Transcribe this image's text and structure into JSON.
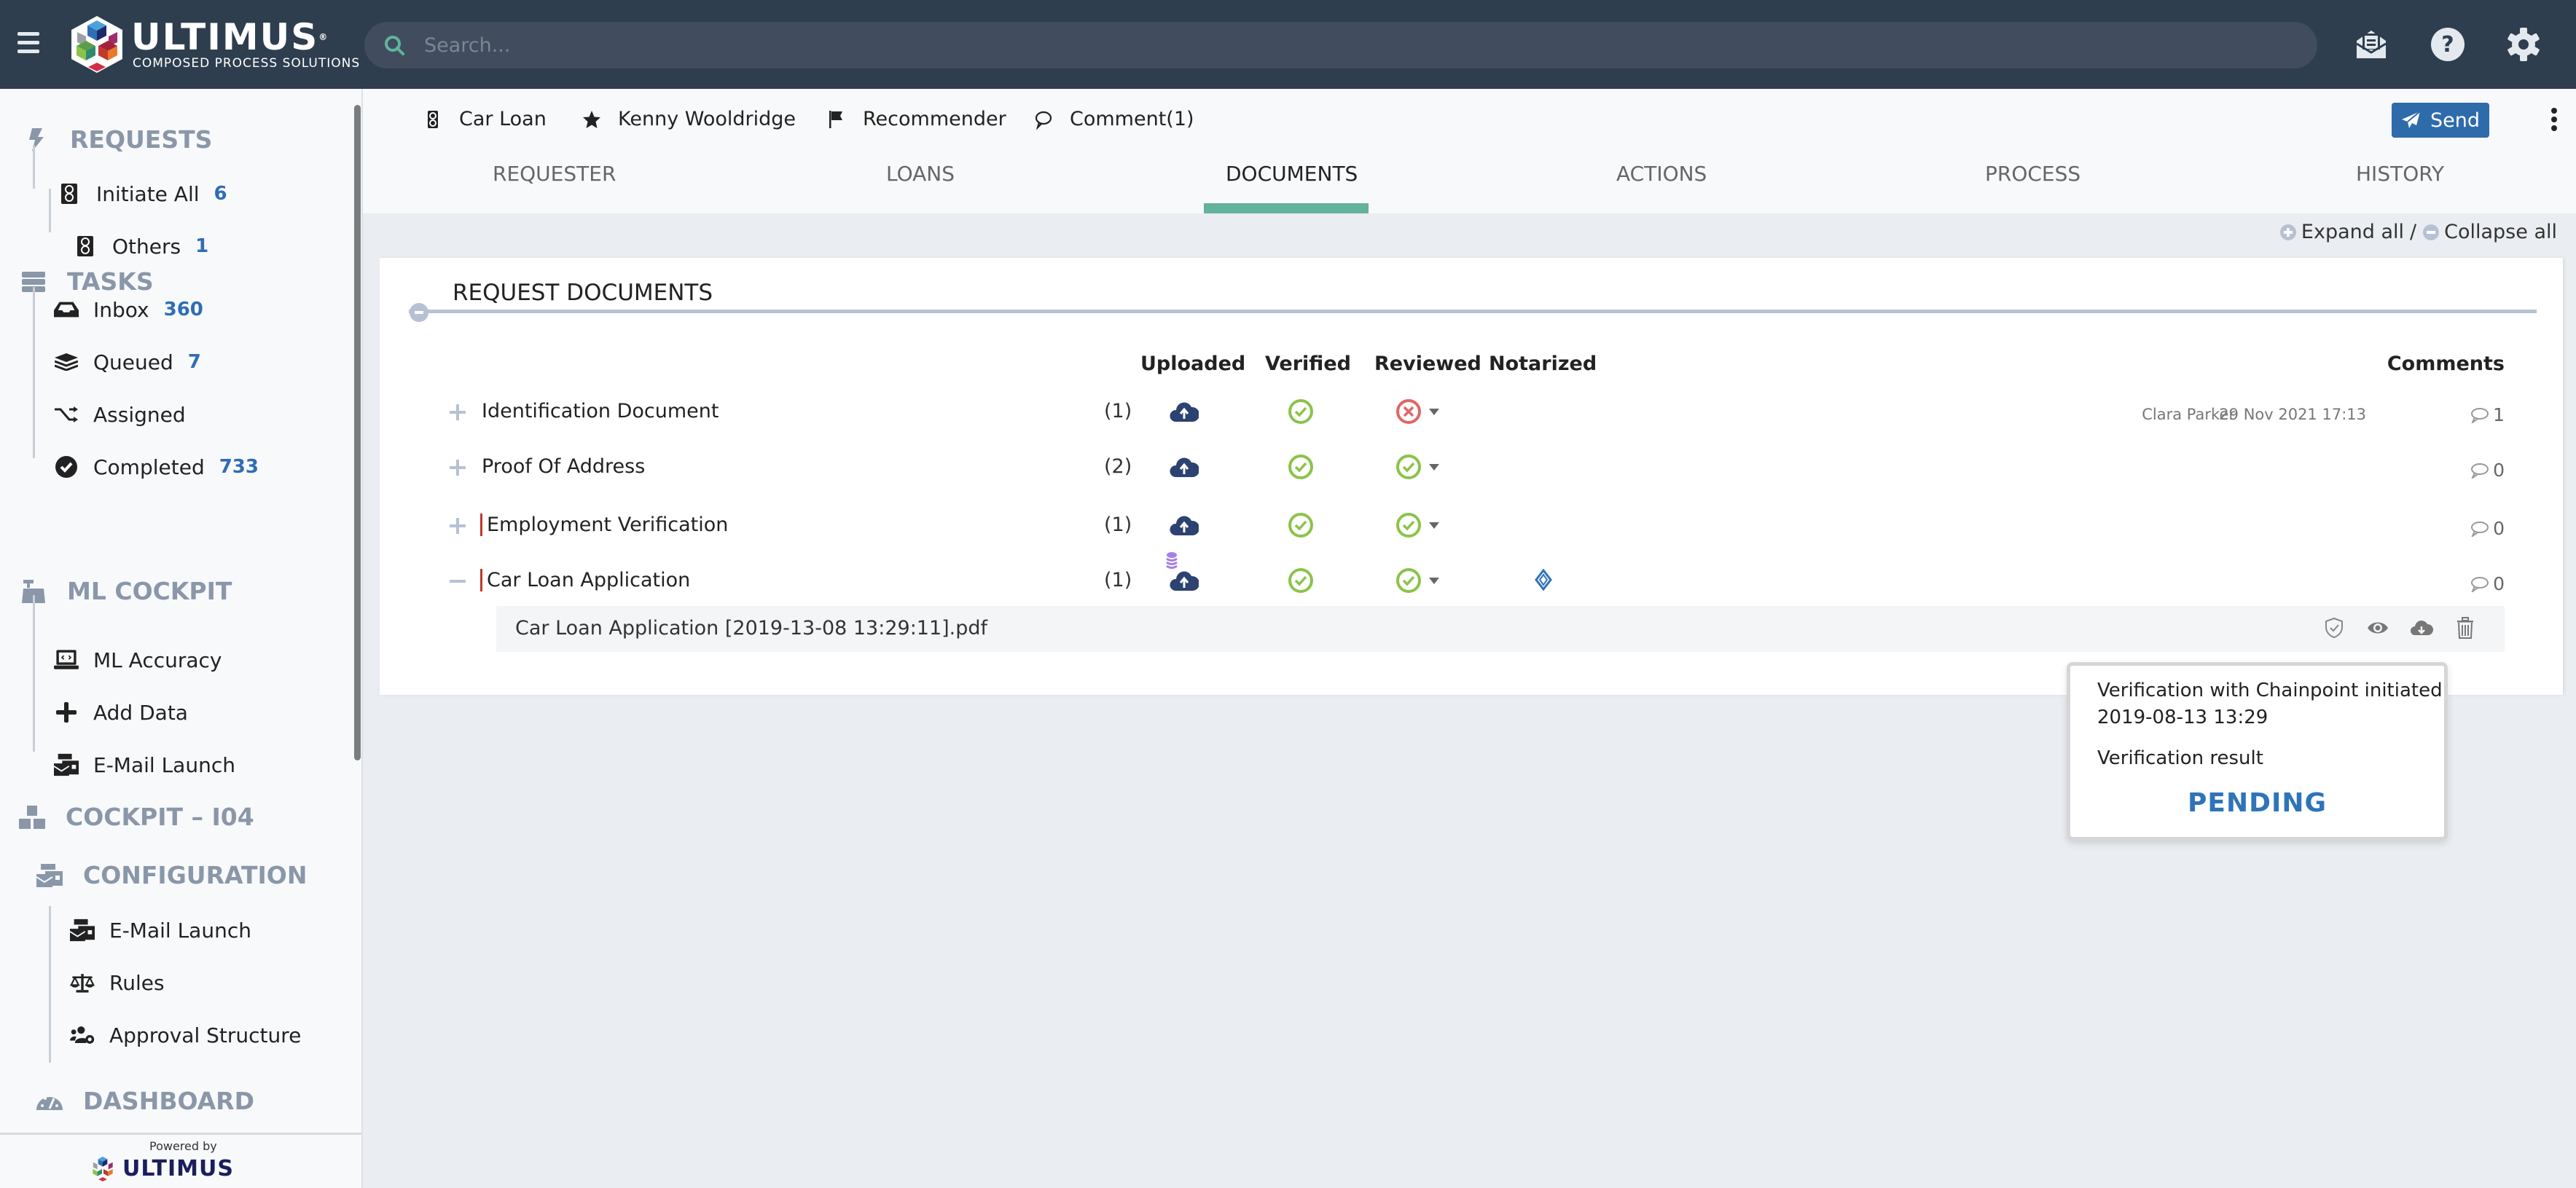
{
  "header": {
    "menu_icon": "hamburger-icon",
    "logo": {
      "name": "ULTIMUS",
      "tagline": "Composed Process Solutions",
      "registered": "®"
    },
    "search": {
      "placeholder": "Search...",
      "value": ""
    },
    "icons": [
      "inbox-mail-icon",
      "help-icon",
      "settings-gear-icon"
    ]
  },
  "sidebar": {
    "sections": [
      {
        "label": "REQUESTS",
        "icon": "bolt-icon"
      },
      {
        "label": "TASKS",
        "icon": "server-icon"
      },
      {
        "label": "ML COCKPIT",
        "icon": "cash-register-icon"
      },
      {
        "label": "COCKPIT – I04",
        "icon": "boxes-icon"
      },
      {
        "label": "CONFIGURATION",
        "icon": "mail-bulk-icon"
      },
      {
        "label": "DASHBOARD",
        "icon": "tachometer-icon"
      }
    ],
    "items": [
      {
        "label": "Initiate All",
        "count": "6",
        "icon": "traffic-light-icon"
      },
      {
        "label": "Others",
        "count": "1",
        "icon": "traffic-light-icon"
      },
      {
        "label": "Inbox",
        "count": "360",
        "icon": "inbox-icon"
      },
      {
        "label": "Queued",
        "count": "7",
        "icon": "layers-icon"
      },
      {
        "label": "Assigned",
        "count": "",
        "icon": "random-icon"
      },
      {
        "label": "Completed",
        "count": "733",
        "icon": "check-circle-icon"
      },
      {
        "label": "ML Accuracy",
        "count": "",
        "icon": "laptop-code-icon"
      },
      {
        "label": "Add Data",
        "count": "",
        "icon": "plus-icon"
      },
      {
        "label": "E-Mail Launch",
        "count": "",
        "icon": "mail-bulk-icon"
      },
      {
        "label": "E-Mail Launch",
        "count": "",
        "icon": "mail-bulk-icon"
      },
      {
        "label": "Rules",
        "count": "",
        "icon": "balance-scale-icon"
      },
      {
        "label": "Approval Structure",
        "count": "",
        "icon": "users-cog-icon"
      }
    ],
    "footer": {
      "powered_by": "Powered by",
      "brand": "ULTIMUS"
    }
  },
  "request": {
    "meta": [
      {
        "label": "Car Loan",
        "icon": "traffic-light-icon"
      },
      {
        "label": "Kenny Wooldridge",
        "icon": "star-icon"
      },
      {
        "label": "Recommender",
        "icon": "flag-icon"
      },
      {
        "label": "Comment(1)",
        "icon": "comment-icon"
      }
    ],
    "send_label": "Send",
    "tabs": [
      {
        "label": "REQUESTER",
        "active": false
      },
      {
        "label": "LOANS",
        "active": false
      },
      {
        "label": "DOCUMENTS",
        "active": true
      },
      {
        "label": "ACTIONS",
        "active": false
      },
      {
        "label": "PROCESS",
        "active": false
      },
      {
        "label": "HISTORY",
        "active": false
      }
    ],
    "expand_all": "Expand all",
    "separator": "/",
    "collapse_all": "Collapse all",
    "accent_color": "#63b29b"
  },
  "documents": {
    "title": "REQUEST DOCUMENTS",
    "columns": {
      "uploaded": "Uploaded",
      "verified": "Verified",
      "reviewed": "Reviewed",
      "notarized": "Notarized",
      "comments": "Comments"
    },
    "rows": [
      {
        "name": "Identification Document",
        "count": "(1)",
        "expanded": false,
        "flagged": false,
        "uploaded": "uploaded",
        "verified": "ok",
        "reviewed": "rejected",
        "notarized": "",
        "comment_author": "Clara Parker",
        "comment_date": "29 Nov 2021 17:13",
        "comments": "1"
      },
      {
        "name": "Proof Of Address",
        "count": "(2)",
        "expanded": false,
        "flagged": false,
        "uploaded": "uploaded",
        "verified": "ok",
        "reviewed": "ok",
        "notarized": "",
        "comment_author": "",
        "comment_date": "",
        "comments": "0"
      },
      {
        "name": "Employment Verification",
        "count": "(1)",
        "expanded": false,
        "flagged": true,
        "uploaded": "uploaded",
        "verified": "ok",
        "reviewed": "ok",
        "notarized": "",
        "comment_author": "",
        "comment_date": "",
        "comments": "0"
      },
      {
        "name": "Car Loan Application",
        "count": "(1)",
        "expanded": true,
        "flagged": true,
        "uploaded": "uploaded-stacked",
        "verified": "ok",
        "reviewed": "ok",
        "notarized": "chainpoint",
        "comment_author": "",
        "comment_date": "",
        "comments": "0"
      }
    ],
    "file": {
      "name": "Car Loan Application [2019-13-08 13:29:11].pdf",
      "actions": [
        "shield-check-icon",
        "eye-icon",
        "cloud-download-icon",
        "trash-icon"
      ]
    },
    "status_colors": {
      "ok": "#8bc34a",
      "rejected": "#e06666",
      "uploaded": "#2c4270"
    }
  },
  "popup": {
    "line1": "Verification with Chainpoint initiated",
    "line2": "2019-08-13 13:29",
    "result_label": "Verification result",
    "status": "PENDING",
    "status_color": "#2e74b9"
  }
}
